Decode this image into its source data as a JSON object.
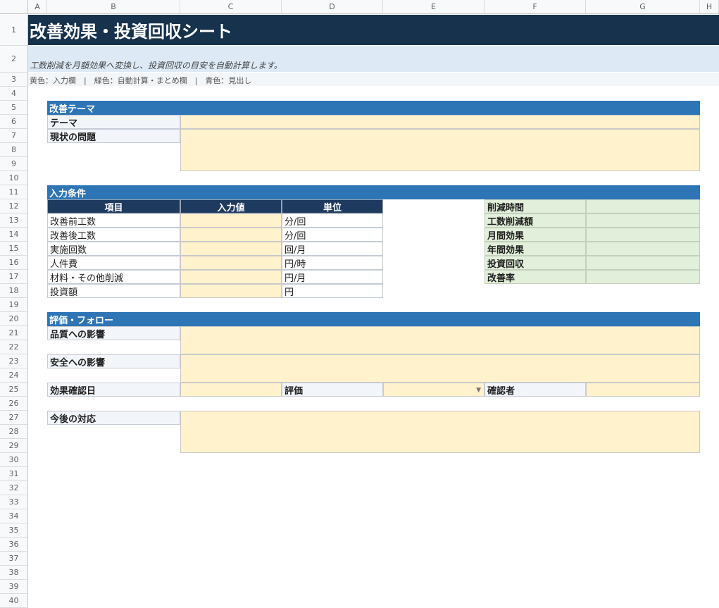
{
  "columns": [
    "A",
    "B",
    "C",
    "D",
    "E",
    "F",
    "G",
    "H"
  ],
  "rows": [
    "1",
    "2",
    "3",
    "4",
    "5",
    "6",
    "7",
    "8",
    "9",
    "10",
    "11",
    "12",
    "13",
    "14",
    "15",
    "16",
    "17",
    "18",
    "19",
    "20",
    "21",
    "22",
    "23",
    "24",
    "25",
    "26",
    "27",
    "28",
    "29",
    "30",
    "31",
    "32",
    "33",
    "34",
    "35",
    "36",
    "37",
    "38",
    "39",
    "40"
  ],
  "title": "改善効果・投資回収シート",
  "subtitle": "工数削減を月額効果へ変換し、投資回収の目安を自動計算します。",
  "legend": "黄色：入力欄　|　緑色：自動計算・まとめ欄　|　青色：見出し",
  "section1": {
    "header": "改善テーマ",
    "theme_label": "テーマ",
    "problem_label": "現状の問題"
  },
  "section2": {
    "header": "入力条件",
    "table_headers": [
      "項目",
      "入力値",
      "単位"
    ],
    "items": [
      {
        "name": "改善前工数",
        "unit": "分/回"
      },
      {
        "name": "改善後工数",
        "unit": "分/回"
      },
      {
        "name": "実施回数",
        "unit": "回/月"
      },
      {
        "name": "人件費",
        "unit": "円/時"
      },
      {
        "name": "材料・その他削減",
        "unit": "円/月"
      },
      {
        "name": "投資額",
        "unit": "円"
      }
    ],
    "summary": [
      "削減時間",
      "工数削減額",
      "月間効果",
      "年間効果",
      "投資回収",
      "改善率"
    ]
  },
  "section3": {
    "header": "評価・フォロー",
    "quality_label": "品質への影響",
    "safety_label": "安全への影響",
    "date_label": "効果確認日",
    "rating_label": "評価",
    "checker_label": "確認者"
  },
  "section4": {
    "future_label": "今後の対応"
  },
  "colors": {
    "title_bg": "#17324d",
    "section": "#2e75b6",
    "input": "#fff2cc",
    "calc": "#e2efda"
  }
}
